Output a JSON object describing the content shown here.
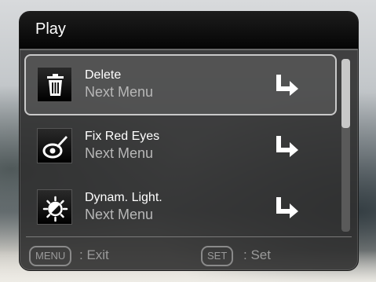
{
  "header": {
    "title": "Play"
  },
  "menu": {
    "items": [
      {
        "label": "Delete",
        "sub": "Next Menu",
        "icon": "trash-icon",
        "selected": true
      },
      {
        "label": "Fix Red Eyes",
        "sub": "Next Menu",
        "icon": "red-eye-fix-icon",
        "selected": false
      },
      {
        "label": "Dynam. Light.",
        "sub": "Next Menu",
        "icon": "dynamic-light-icon",
        "selected": false
      }
    ],
    "arrow_icon": "enter-arrow-icon"
  },
  "footer": {
    "menu_key": "MENU",
    "menu_action": ": Exit",
    "set_key": "SET",
    "set_action": ": Set"
  },
  "colors": {
    "panel": "#303030",
    "title_bar": "#050505",
    "text_primary": "#ffffff",
    "text_secondary": "#b7b7b7",
    "selection_border": "#c9c9c9",
    "footer_text": "#9a9a9a"
  }
}
